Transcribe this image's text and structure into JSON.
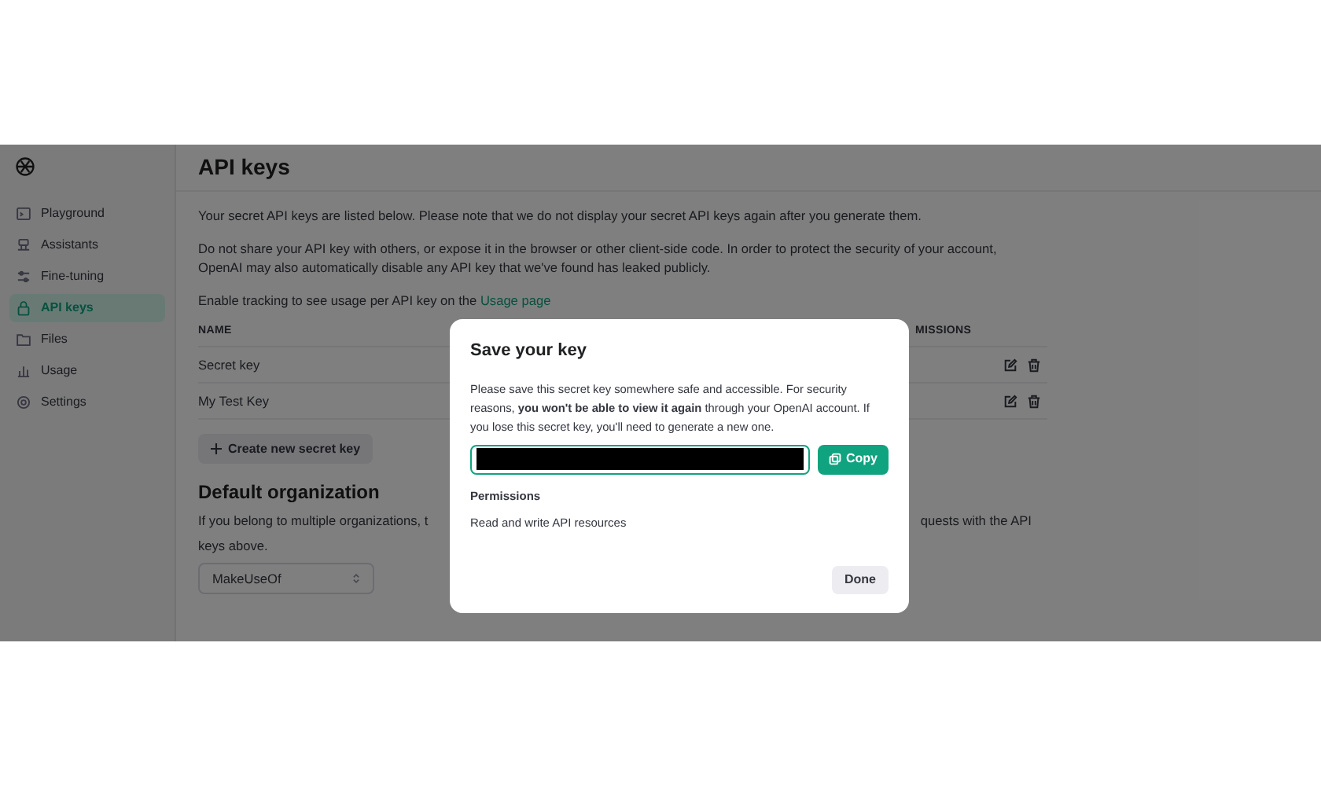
{
  "sidebar": {
    "items": [
      {
        "label": "Playground",
        "selected": false
      },
      {
        "label": "Assistants",
        "selected": false
      },
      {
        "label": "Fine-tuning",
        "selected": false
      },
      {
        "label": "API keys",
        "selected": true
      },
      {
        "label": "Files",
        "selected": false
      },
      {
        "label": "Usage",
        "selected": false
      },
      {
        "label": "Settings",
        "selected": false
      }
    ]
  },
  "page": {
    "title": "API keys",
    "paragraphs": [
      "Your secret API keys are listed below. Please note that we do not display your secret API keys again after you generate them.",
      "Do not share your API key with others, or expose it in the browser or other client-side code. In order to protect the security of your account, OpenAI may also automatically disable any API key that we've found has leaked publicly."
    ],
    "tracking": {
      "text": "Enable tracking to see usage per API key on the",
      "link": "Usage page"
    }
  },
  "table": {
    "columns": [
      "NAME",
      "MISSIONS"
    ],
    "rows": [
      {
        "name": "Secret key"
      },
      {
        "name": "My Test Key"
      }
    ]
  },
  "create_button": "Create new secret key",
  "default_organization": {
    "title": "Default organization",
    "text_left": "If you belong to multiple organizations, t",
    "text_right": "quests with the API",
    "text_end": "keys above.",
    "select_value": "MakeUseOf"
  },
  "modal": {
    "title": "Save your key",
    "message": "Please save this secret key somewhere safe and accessible. For security reasons, **you won't be able to view it again** through your OpenAI account. If you lose this secret key, you'll need to generate a new one.",
    "copy_button": "Copy",
    "permissions_label": "Permissions",
    "permissions_value": "Read and write API resources",
    "done_button": "Done"
  }
}
